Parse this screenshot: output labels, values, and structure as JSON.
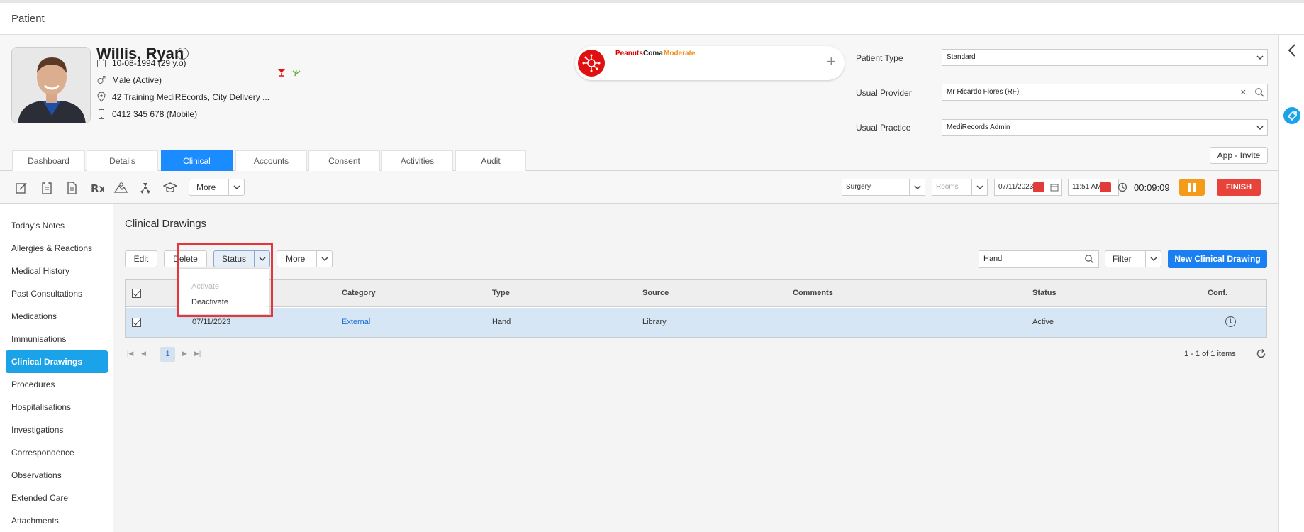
{
  "page_title": "Patient",
  "patient": {
    "name": "Willis, Ryan",
    "dob": "10-08-1994 (29 y.o)",
    "gender": "Male (Active)",
    "address": "42 Training MediREcords, City Delivery ...",
    "phone": "0412 345 678 (Mobile)"
  },
  "allergy": {
    "allergen": "Peanuts",
    "reaction": "Coma",
    "severity": "Moderate"
  },
  "fields": {
    "patient_type_label": "Patient Type",
    "patient_type_value": "Standard",
    "usual_provider_label": "Usual Provider",
    "usual_provider_value": "Mr Ricardo Flores (RF)",
    "usual_practice_label": "Usual Practice",
    "usual_practice_value": "MediRecords Admin"
  },
  "app_invite_label": "App - Invite",
  "tabs": [
    {
      "label": "Dashboard"
    },
    {
      "label": "Details"
    },
    {
      "label": "Clinical"
    },
    {
      "label": "Accounts"
    },
    {
      "label": "Consent"
    },
    {
      "label": "Activities"
    },
    {
      "label": "Audit"
    }
  ],
  "toolbar": {
    "more_label": "More",
    "location_value": "Surgery",
    "rooms_placeholder": "Rooms",
    "date_value": "07/11/2023",
    "time_value": "11:51 AM",
    "timer": "00:09:09",
    "finish_label": "FINISH"
  },
  "sidebar": {
    "items": [
      {
        "label": "Today's Notes"
      },
      {
        "label": "Allergies & Reactions"
      },
      {
        "label": "Medical History"
      },
      {
        "label": "Past Consultations"
      },
      {
        "label": "Medications"
      },
      {
        "label": "Immunisations"
      },
      {
        "label": "Clinical Drawings"
      },
      {
        "label": "Procedures"
      },
      {
        "label": "Hospitalisations"
      },
      {
        "label": "Investigations"
      },
      {
        "label": "Correspondence"
      },
      {
        "label": "Observations"
      },
      {
        "label": "Extended Care"
      },
      {
        "label": "Attachments"
      }
    ]
  },
  "main": {
    "title": "Clinical Drawings",
    "buttons": {
      "edit": "Edit",
      "delete": "Delete",
      "status": "Status",
      "more": "More",
      "filter": "Filter",
      "new": "New Clinical Drawing"
    },
    "search_value": "Hand",
    "status_menu": {
      "activate": "Activate",
      "deactivate": "Deactivate"
    },
    "columns": {
      "category": "Category",
      "type": "Type",
      "source": "Source",
      "comments": "Comments",
      "status": "Status",
      "conf": "Conf."
    },
    "rows": [
      {
        "date": "07/11/2023",
        "category": "External",
        "type": "Hand",
        "source": "Library",
        "comments": "",
        "status": "Active"
      }
    ],
    "pager": {
      "current_page": "1",
      "info": "1 - 1 of 1 items"
    }
  },
  "colors": {
    "primary": "#1a8cff",
    "sidebar_active": "#1aa3e8",
    "finish": "#e8433a",
    "pause": "#f59b1a",
    "highlight": "#e2383d"
  }
}
